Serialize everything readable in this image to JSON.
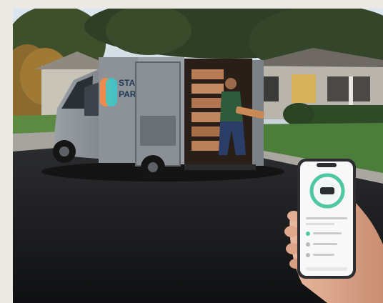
{
  "van": {
    "logo_line1": "STAR",
    "logo_line2": "PARC",
    "logo_colors": [
      "#f08a4b",
      "#3cc8c8"
    ]
  },
  "colors": {
    "sky": "#dfe8ef",
    "road": "#151618",
    "grass": "#4a7a3b",
    "van_body": "#8a8f95",
    "phone_ring": "#4ec7a3"
  },
  "phone": {
    "app_icon": "van-icon"
  }
}
